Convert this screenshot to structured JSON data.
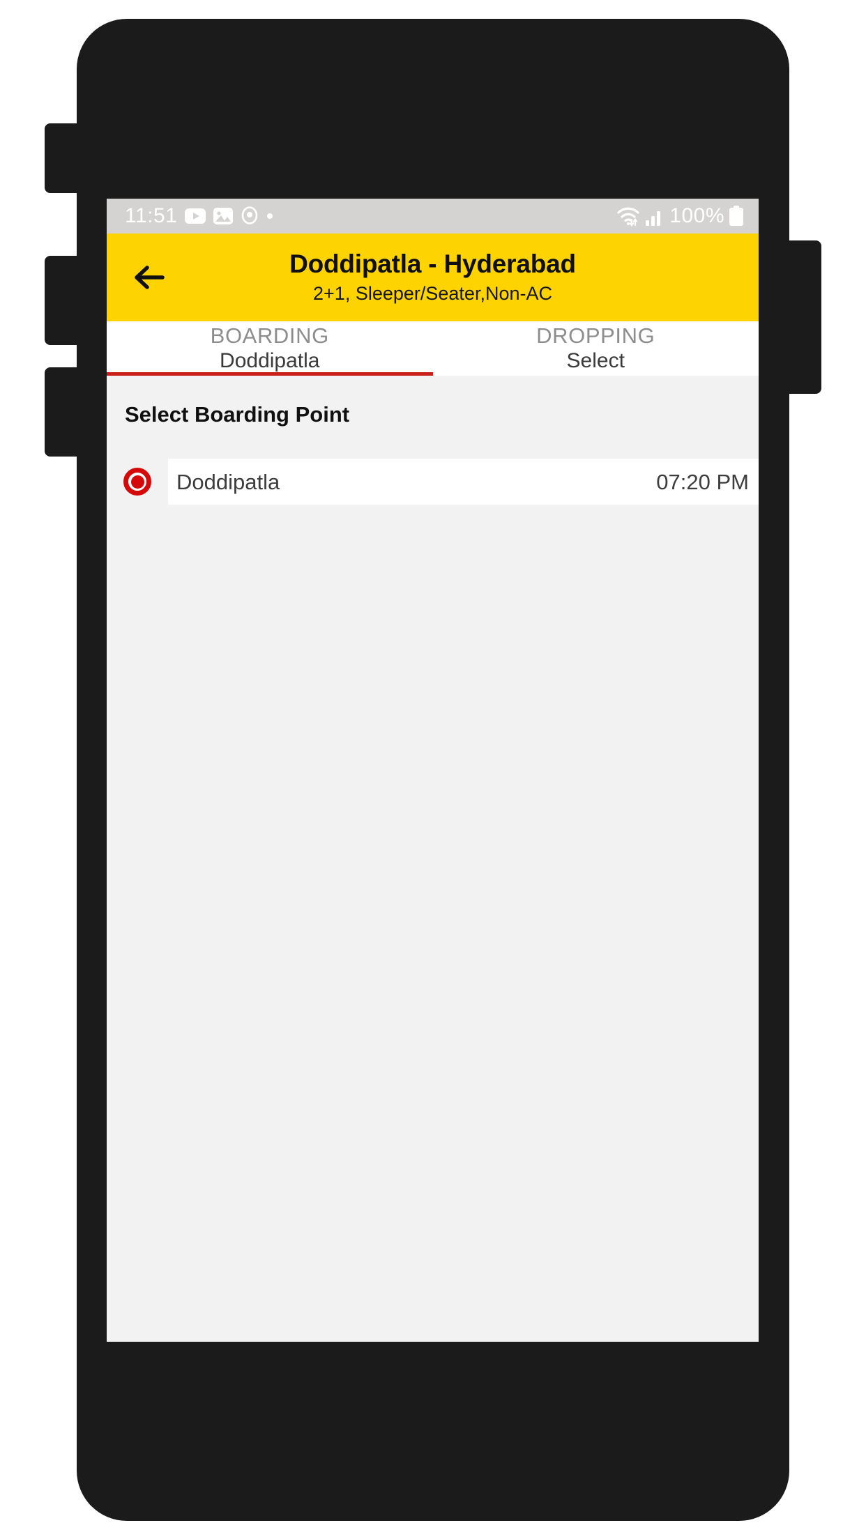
{
  "status_bar": {
    "clock": "11:51",
    "left_icons": [
      "youtube-icon",
      "gallery-icon",
      "location-icon",
      "dot-icon"
    ],
    "right_icons": [
      "wifi-icon",
      "signal-icon"
    ],
    "battery_percent": "100%",
    "battery_icon": "battery-full-icon",
    "background_color": "#d5d3d1"
  },
  "app_bar": {
    "back_icon": "back-arrow-icon",
    "title": "Doddipatla - Hyderabad",
    "subtitle": "2+1, Sleeper/Seater,Non-AC",
    "background_color": "#fdd302"
  },
  "tabs": {
    "active_index": 0,
    "indicator_color": "#c81f19",
    "items": [
      {
        "label": "BOARDING",
        "value": "Doddipatla"
      },
      {
        "label": "DROPPING",
        "value": "Select"
      }
    ]
  },
  "content": {
    "section_title": "Select Boarding Point",
    "points": [
      {
        "name": "Doddipatla",
        "time": "07:20 PM",
        "selected": true
      }
    ],
    "selected_color": "#d40a0a",
    "background_color": "#f2f2f2"
  },
  "nav_bar": {
    "buttons": [
      "recents-icon",
      "home-icon",
      "back-icon"
    ],
    "background_color": "#000000"
  }
}
